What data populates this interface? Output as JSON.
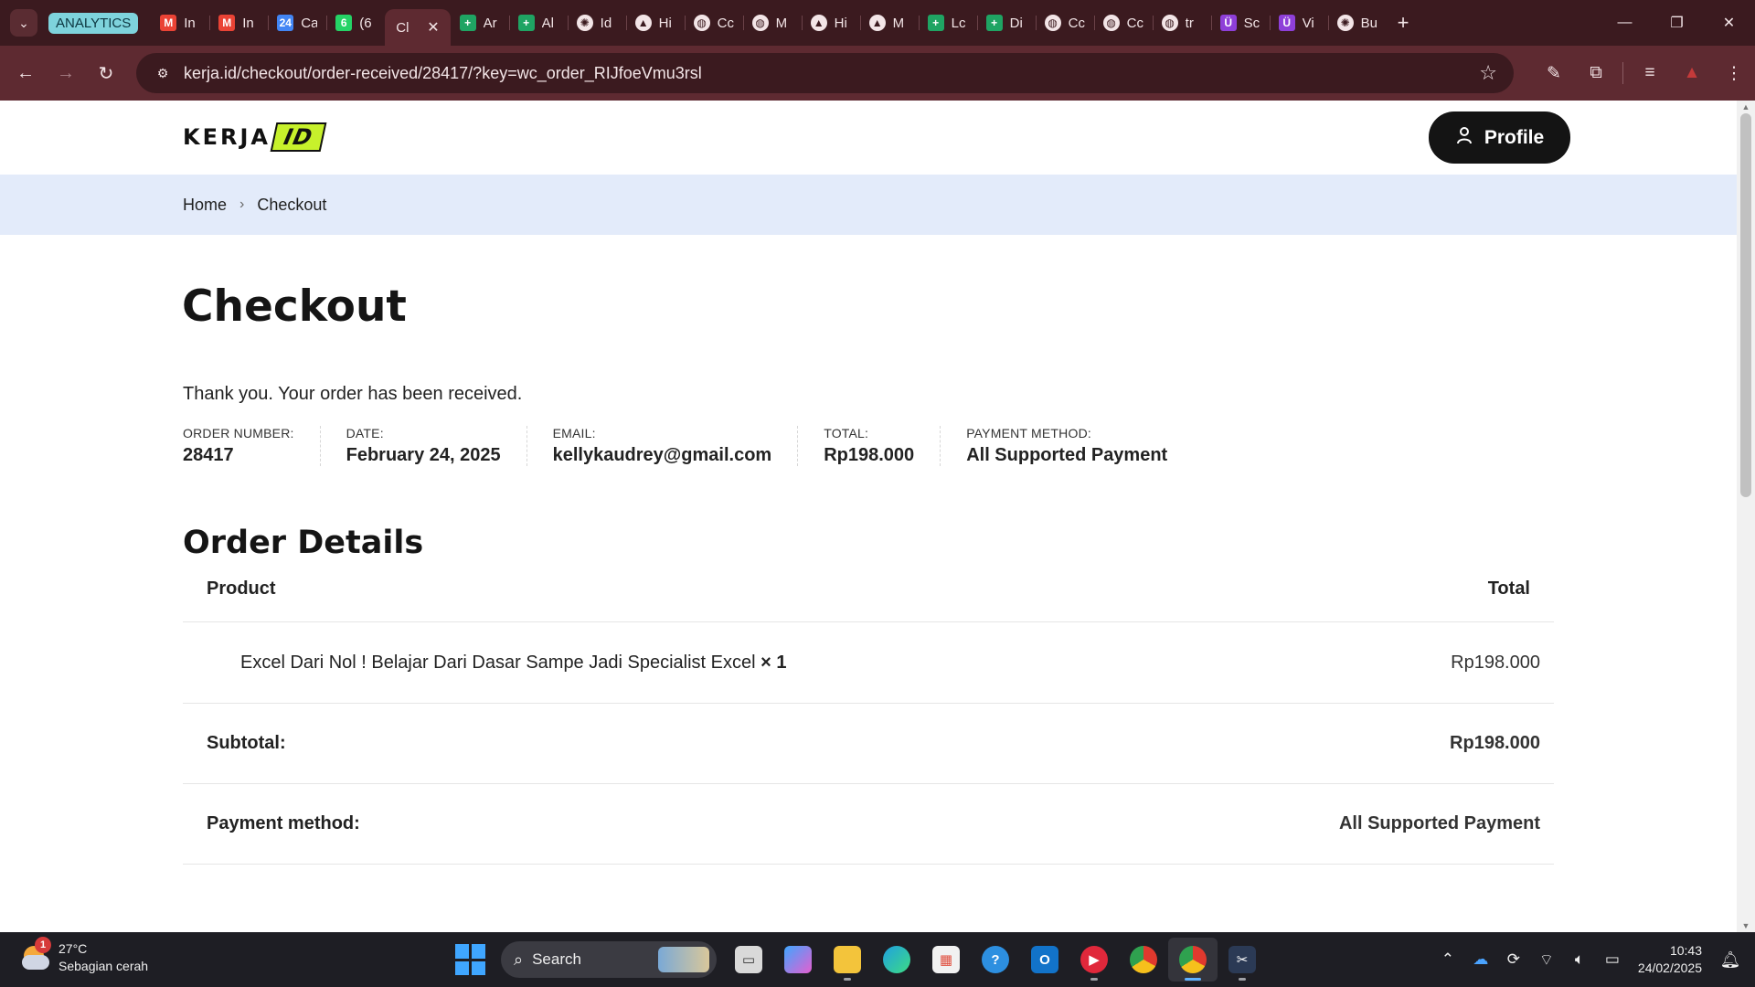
{
  "browser": {
    "tab_group": "ANALYTICS",
    "tabs": [
      {
        "label": "In",
        "icon": "gmail-icon",
        "icon_text": "M",
        "color": "#ea4335"
      },
      {
        "label": "In",
        "icon": "gmail-icon",
        "icon_text": "M",
        "color": "#ea4335"
      },
      {
        "label": "Ca",
        "icon": "calendar-icon",
        "icon_text": "24",
        "color": "#4285f4"
      },
      {
        "label": "(6",
        "icon": "whatsapp-icon",
        "icon_text": "6",
        "color": "#25d366"
      },
      {
        "label": "Cl",
        "icon": "none",
        "icon_text": "",
        "color": "",
        "active": true
      },
      {
        "label": "Ar",
        "icon": "sheets-icon",
        "icon_text": "+",
        "color": "#1fa463"
      },
      {
        "label": "Al",
        "icon": "sheets-icon",
        "icon_text": "+",
        "color": "#1fa463"
      },
      {
        "label": "Id",
        "icon": "openai-icon",
        "icon_text": "✺",
        "color": "#3b1a1f"
      },
      {
        "label": "Hi",
        "icon": "drive-icon",
        "icon_text": "▲",
        "color": "#3b1a1f"
      },
      {
        "label": "Cc",
        "icon": "globe-icon",
        "icon_text": "◍",
        "color": "#3b1a1f"
      },
      {
        "label": "M",
        "icon": "globe-icon",
        "icon_text": "◍",
        "color": "#3b1a1f"
      },
      {
        "label": "Hi",
        "icon": "drive-icon",
        "icon_text": "▲",
        "color": "#3b1a1f"
      },
      {
        "label": "M",
        "icon": "drive-icon",
        "icon_text": "▲",
        "color": "#3b1a1f"
      },
      {
        "label": "Lc",
        "icon": "sheets-icon",
        "icon_text": "+",
        "color": "#1fa463"
      },
      {
        "label": "Di",
        "icon": "sheets-icon",
        "icon_text": "+",
        "color": "#1fa463"
      },
      {
        "label": "Cc",
        "icon": "globe-icon",
        "icon_text": "◍",
        "color": "#3b1a1f"
      },
      {
        "label": "Cc",
        "icon": "globe-icon",
        "icon_text": "◍",
        "color": "#3b1a1f"
      },
      {
        "label": "tr",
        "icon": "globe-icon",
        "icon_text": "◍",
        "color": "#3b1a1f"
      },
      {
        "label": "Sc",
        "icon": "u-app-icon",
        "icon_text": "Ü",
        "color": "#8e3fd8"
      },
      {
        "label": "Vi",
        "icon": "u-app-icon",
        "icon_text": "Ü",
        "color": "#8e3fd8"
      },
      {
        "label": "Bu",
        "icon": "openai-icon",
        "icon_text": "✺",
        "color": "#3b1a1f"
      }
    ],
    "url": "kerja.id/checkout/order-received/28417/?key=wc_order_RIJfoeVmu3rsl"
  },
  "site": {
    "logo_text": "KERJA",
    "logo_badge": "ID",
    "profile_label": "Profile",
    "breadcrumb": [
      "Home",
      "Checkout"
    ]
  },
  "checkout": {
    "title": "Checkout",
    "thanks": "Thank you. Your order has been received.",
    "overview": [
      {
        "label": "ORDER NUMBER:",
        "value": "28417"
      },
      {
        "label": "DATE:",
        "value": "February 24, 2025"
      },
      {
        "label": "EMAIL:",
        "value": "kellykaudrey@gmail.com"
      },
      {
        "label": "TOTAL:",
        "value": "Rp198.000"
      },
      {
        "label": "PAYMENT METHOD:",
        "value": "All Supported Payment"
      }
    ],
    "details_title": "Order Details",
    "table": {
      "head_product": "Product",
      "head_total": "Total",
      "item_name": "Excel Dari Nol ! Belajar Dari Dasar Sampe Jadi Specialist Excel",
      "item_qty": "× 1",
      "item_total": "Rp198.000",
      "subtotal_label": "Subtotal:",
      "subtotal_value": "Rp198.000",
      "payment_label": "Payment method:",
      "payment_value": "All Supported Payment"
    }
  },
  "taskbar": {
    "weather_temp": "27°C",
    "weather_desc": "Sebagian cerah",
    "weather_badge": "1",
    "search_label": "Search",
    "time": "10:43",
    "date": "24/02/2025"
  }
}
